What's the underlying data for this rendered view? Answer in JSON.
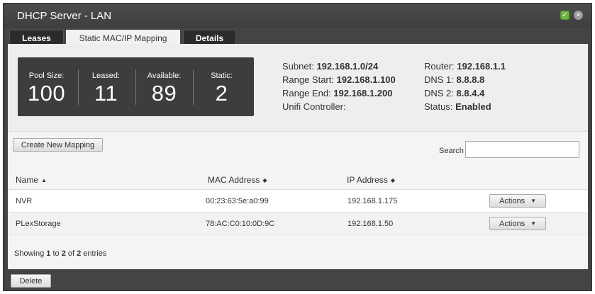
{
  "window": {
    "title": "DHCP Server - LAN",
    "ok_icon": "checkmark-icon",
    "close_icon": "close-icon"
  },
  "tabs": [
    {
      "label": "Leases",
      "active": false
    },
    {
      "label": "Static MAC/IP Mapping",
      "active": true
    },
    {
      "label": "Details",
      "active": false
    }
  ],
  "stats": [
    {
      "label": "Pool Size:",
      "value": "100"
    },
    {
      "label": "Leased:",
      "value": "11"
    },
    {
      "label": "Available:",
      "value": "89"
    },
    {
      "label": "Static:",
      "value": "2"
    }
  ],
  "info_left": [
    {
      "label": "Subnet:",
      "value": "192.168.1.0/24"
    },
    {
      "label": "Range Start:",
      "value": "192.168.1.100"
    },
    {
      "label": "Range End:",
      "value": "192.168.1.200"
    },
    {
      "label": "Unifi Controller:",
      "value": ""
    }
  ],
  "info_right": [
    {
      "label": "Router:",
      "value": "192.168.1.1"
    },
    {
      "label": "DNS 1:",
      "value": "8.8.8.8"
    },
    {
      "label": "DNS 2:",
      "value": "8.8.4.4"
    },
    {
      "label": "Status:",
      "value": "Enabled"
    }
  ],
  "toolbar": {
    "create_label": "Create New Mapping",
    "search_label": "Search",
    "search_value": ""
  },
  "table": {
    "columns": [
      "Name",
      "MAC Address",
      "IP Address"
    ],
    "rows": [
      {
        "name": "NVR",
        "mac": "00:23:63:5e:a0:99",
        "ip": "192.168.1.175",
        "action": "Actions"
      },
      {
        "name": "PLexStorage",
        "mac": "78:AC:C0:10:0D:9C",
        "ip": "192.168.1.50",
        "action": "Actions"
      }
    ]
  },
  "footer": {
    "prefix": "Showing ",
    "from": "1",
    "to_word": " to ",
    "to": "2",
    "of_word": " of ",
    "total": "2",
    "suffix": " entries"
  },
  "bottom": {
    "delete_label": "Delete"
  },
  "colors": {
    "window_bg": "#444444",
    "ok_green": "#6db33f",
    "panel_dark": "#3d3d3d"
  }
}
